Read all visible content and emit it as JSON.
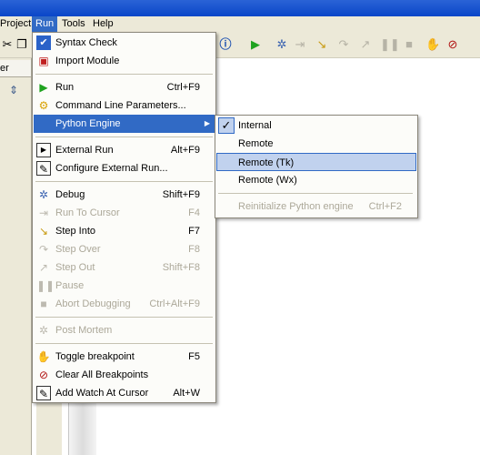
{
  "menubar": {
    "items": [
      "Project",
      "Run",
      "Tools",
      "Help"
    ],
    "active": "Run"
  },
  "left_panel": {
    "tab_label": "er"
  },
  "run_menu": {
    "syntax_check": {
      "label": "Syntax Check",
      "shortcut": ""
    },
    "import_module": {
      "label": "Import Module",
      "shortcut": ""
    },
    "run": {
      "label": "Run",
      "shortcut": "Ctrl+F9"
    },
    "command_line_parameters": {
      "label": "Command Line Parameters...",
      "shortcut": ""
    },
    "python_engine": {
      "label": "Python Engine",
      "shortcut": ""
    },
    "external_run": {
      "label": "External Run",
      "shortcut": "Alt+F9"
    },
    "configure_external_run": {
      "label": "Configure External Run...",
      "shortcut": ""
    },
    "debug": {
      "label": "Debug",
      "shortcut": "Shift+F9"
    },
    "run_to_cursor": {
      "label": "Run To Cursor",
      "shortcut": "F4"
    },
    "step_into": {
      "label": "Step Into",
      "shortcut": "F7"
    },
    "step_over": {
      "label": "Step Over",
      "shortcut": "F8"
    },
    "step_out": {
      "label": "Step Out",
      "shortcut": "Shift+F8"
    },
    "pause": {
      "label": "Pause",
      "shortcut": ""
    },
    "abort_debugging": {
      "label": "Abort Debugging",
      "shortcut": "Ctrl+Alt+F9"
    },
    "post_mortem": {
      "label": "Post Mortem",
      "shortcut": ""
    },
    "toggle_breakpoint": {
      "label": "Toggle breakpoint",
      "shortcut": "F5"
    },
    "clear_all_breakpoints": {
      "label": "Clear All Breakpoints",
      "shortcut": ""
    },
    "add_watch_at_cursor": {
      "label": "Add Watch At Cursor",
      "shortcut": "Alt+W"
    }
  },
  "python_engine_submenu": {
    "internal": {
      "label": "Internal",
      "checked": true
    },
    "remote": {
      "label": "Remote"
    },
    "remote_tk": {
      "label": "Remote (Tk)",
      "highlighted": true
    },
    "remote_wx": {
      "label": "Remote (Wx)"
    },
    "reinitialize": {
      "label": "Reinitialize Python engine",
      "shortcut": "Ctrl+F2",
      "disabled": true
    }
  },
  "colors": {
    "menu_highlight": "#316ac5",
    "submenu_highlight": "#c1d2ee",
    "disabled_text": "#aca899",
    "title_bar": "#0a46c8"
  }
}
